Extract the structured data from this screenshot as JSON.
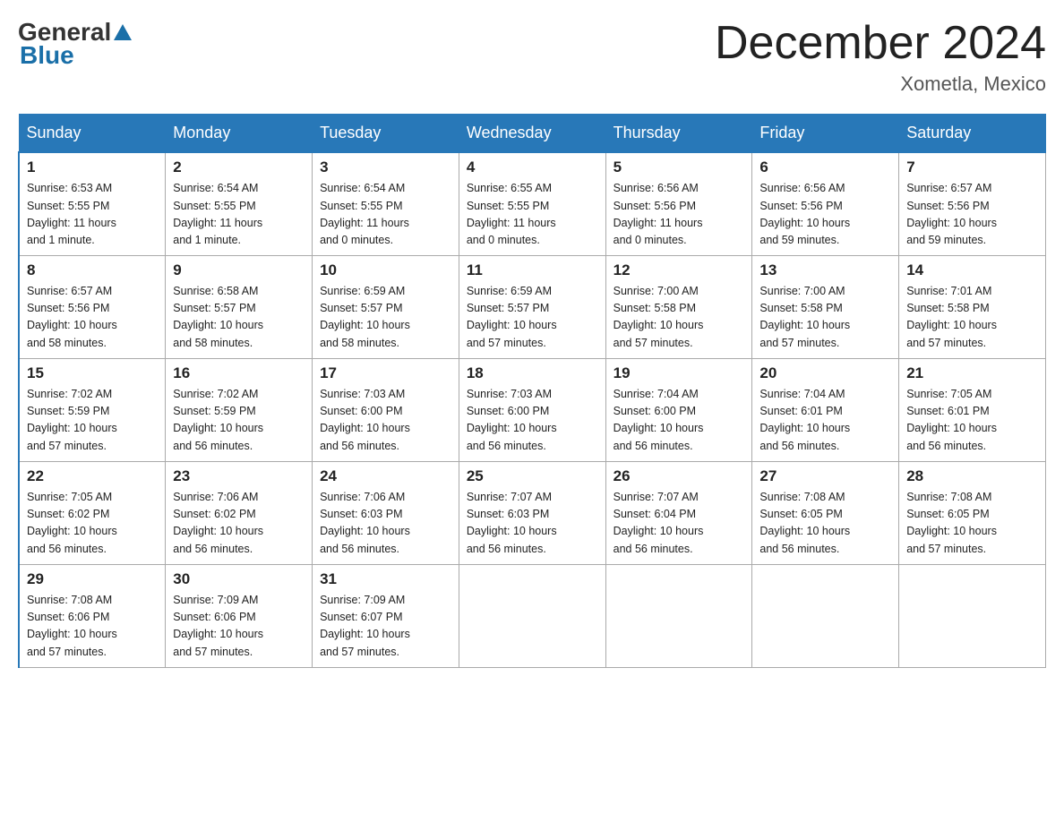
{
  "header": {
    "logo_general": "General",
    "logo_blue": "Blue",
    "title": "December 2024",
    "subtitle": "Xometla, Mexico"
  },
  "days_of_week": [
    "Sunday",
    "Monday",
    "Tuesday",
    "Wednesday",
    "Thursday",
    "Friday",
    "Saturday"
  ],
  "weeks": [
    [
      {
        "day": "1",
        "sunrise": "6:53 AM",
        "sunset": "5:55 PM",
        "daylight": "11 hours and 1 minute."
      },
      {
        "day": "2",
        "sunrise": "6:54 AM",
        "sunset": "5:55 PM",
        "daylight": "11 hours and 1 minute."
      },
      {
        "day": "3",
        "sunrise": "6:54 AM",
        "sunset": "5:55 PM",
        "daylight": "11 hours and 0 minutes."
      },
      {
        "day": "4",
        "sunrise": "6:55 AM",
        "sunset": "5:55 PM",
        "daylight": "11 hours and 0 minutes."
      },
      {
        "day": "5",
        "sunrise": "6:56 AM",
        "sunset": "5:56 PM",
        "daylight": "11 hours and 0 minutes."
      },
      {
        "day": "6",
        "sunrise": "6:56 AM",
        "sunset": "5:56 PM",
        "daylight": "10 hours and 59 minutes."
      },
      {
        "day": "7",
        "sunrise": "6:57 AM",
        "sunset": "5:56 PM",
        "daylight": "10 hours and 59 minutes."
      }
    ],
    [
      {
        "day": "8",
        "sunrise": "6:57 AM",
        "sunset": "5:56 PM",
        "daylight": "10 hours and 58 minutes."
      },
      {
        "day": "9",
        "sunrise": "6:58 AM",
        "sunset": "5:57 PM",
        "daylight": "10 hours and 58 minutes."
      },
      {
        "day": "10",
        "sunrise": "6:59 AM",
        "sunset": "5:57 PM",
        "daylight": "10 hours and 58 minutes."
      },
      {
        "day": "11",
        "sunrise": "6:59 AM",
        "sunset": "5:57 PM",
        "daylight": "10 hours and 57 minutes."
      },
      {
        "day": "12",
        "sunrise": "7:00 AM",
        "sunset": "5:58 PM",
        "daylight": "10 hours and 57 minutes."
      },
      {
        "day": "13",
        "sunrise": "7:00 AM",
        "sunset": "5:58 PM",
        "daylight": "10 hours and 57 minutes."
      },
      {
        "day": "14",
        "sunrise": "7:01 AM",
        "sunset": "5:58 PM",
        "daylight": "10 hours and 57 minutes."
      }
    ],
    [
      {
        "day": "15",
        "sunrise": "7:02 AM",
        "sunset": "5:59 PM",
        "daylight": "10 hours and 57 minutes."
      },
      {
        "day": "16",
        "sunrise": "7:02 AM",
        "sunset": "5:59 PM",
        "daylight": "10 hours and 56 minutes."
      },
      {
        "day": "17",
        "sunrise": "7:03 AM",
        "sunset": "6:00 PM",
        "daylight": "10 hours and 56 minutes."
      },
      {
        "day": "18",
        "sunrise": "7:03 AM",
        "sunset": "6:00 PM",
        "daylight": "10 hours and 56 minutes."
      },
      {
        "day": "19",
        "sunrise": "7:04 AM",
        "sunset": "6:00 PM",
        "daylight": "10 hours and 56 minutes."
      },
      {
        "day": "20",
        "sunrise": "7:04 AM",
        "sunset": "6:01 PM",
        "daylight": "10 hours and 56 minutes."
      },
      {
        "day": "21",
        "sunrise": "7:05 AM",
        "sunset": "6:01 PM",
        "daylight": "10 hours and 56 minutes."
      }
    ],
    [
      {
        "day": "22",
        "sunrise": "7:05 AM",
        "sunset": "6:02 PM",
        "daylight": "10 hours and 56 minutes."
      },
      {
        "day": "23",
        "sunrise": "7:06 AM",
        "sunset": "6:02 PM",
        "daylight": "10 hours and 56 minutes."
      },
      {
        "day": "24",
        "sunrise": "7:06 AM",
        "sunset": "6:03 PM",
        "daylight": "10 hours and 56 minutes."
      },
      {
        "day": "25",
        "sunrise": "7:07 AM",
        "sunset": "6:03 PM",
        "daylight": "10 hours and 56 minutes."
      },
      {
        "day": "26",
        "sunrise": "7:07 AM",
        "sunset": "6:04 PM",
        "daylight": "10 hours and 56 minutes."
      },
      {
        "day": "27",
        "sunrise": "7:08 AM",
        "sunset": "6:05 PM",
        "daylight": "10 hours and 56 minutes."
      },
      {
        "day": "28",
        "sunrise": "7:08 AM",
        "sunset": "6:05 PM",
        "daylight": "10 hours and 57 minutes."
      }
    ],
    [
      {
        "day": "29",
        "sunrise": "7:08 AM",
        "sunset": "6:06 PM",
        "daylight": "10 hours and 57 minutes."
      },
      {
        "day": "30",
        "sunrise": "7:09 AM",
        "sunset": "6:06 PM",
        "daylight": "10 hours and 57 minutes."
      },
      {
        "day": "31",
        "sunrise": "7:09 AM",
        "sunset": "6:07 PM",
        "daylight": "10 hours and 57 minutes."
      },
      null,
      null,
      null,
      null
    ]
  ],
  "labels": {
    "sunrise": "Sunrise:",
    "sunset": "Sunset:",
    "daylight": "Daylight:"
  }
}
